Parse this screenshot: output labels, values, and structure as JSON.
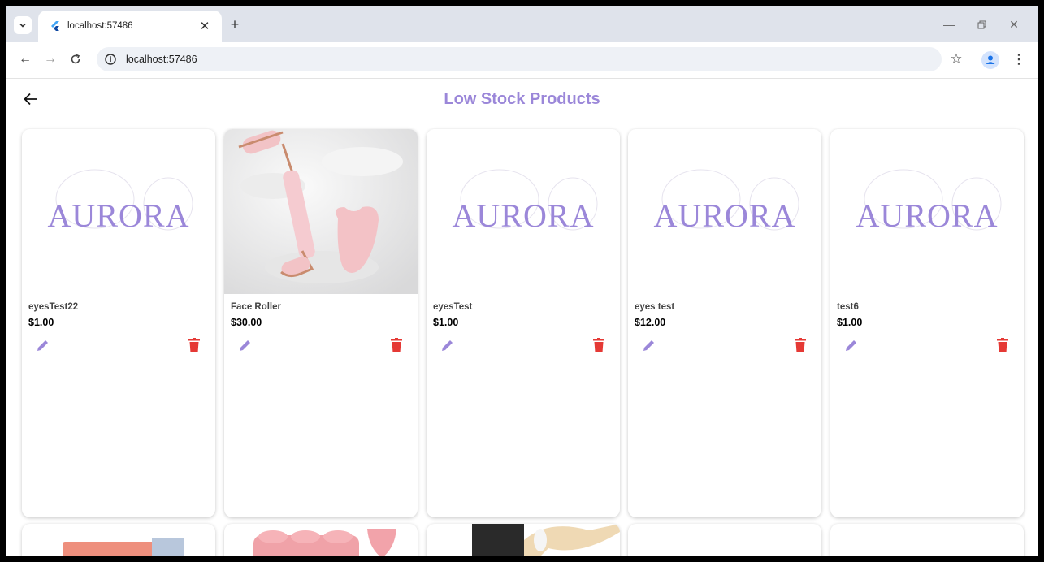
{
  "browser": {
    "tab_title": "localhost:57486",
    "url": "localhost:57486"
  },
  "app": {
    "title": "Low Stock Products",
    "accent_color": "#9b87d9",
    "delete_color": "#e53935"
  },
  "products": [
    {
      "name": "eyesTest22",
      "price": "$1.00",
      "image": "aurora-logo"
    },
    {
      "name": "Face Roller",
      "price": "$30.00",
      "image": "face-roller-photo"
    },
    {
      "name": "eyesTest",
      "price": "$1.00",
      "image": "aurora-logo"
    },
    {
      "name": "eyes test",
      "price": "$12.00",
      "image": "aurora-logo"
    },
    {
      "name": "test6",
      "price": "$1.00",
      "image": "aurora-logo"
    }
  ],
  "logo_text": "AURORA",
  "icons": {
    "edit": "pencil-icon",
    "delete": "trash-icon",
    "back": "arrow-left-icon"
  }
}
